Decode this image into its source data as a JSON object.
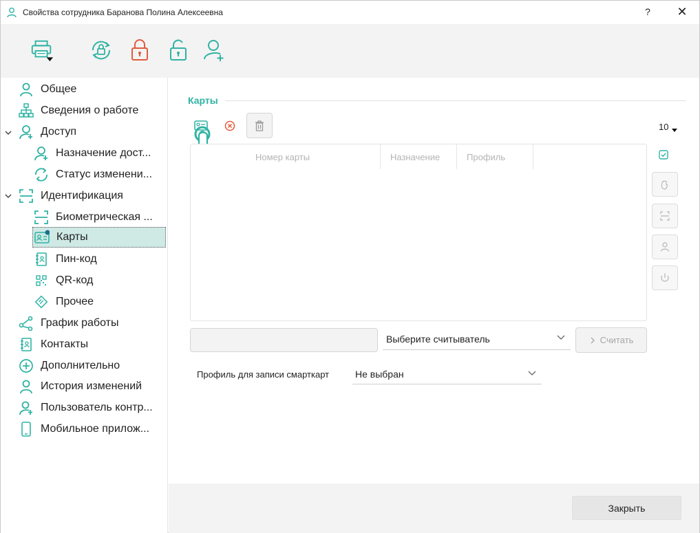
{
  "window": {
    "title": "Свойства сотрудника Баранова Полина  Алексеевна",
    "help_label": "?",
    "close_label": "✕"
  },
  "toolbar": {
    "buttons": [
      {
        "name": "print-icon",
        "color": "#2fb3a3"
      },
      {
        "name": "sync-lock-icon",
        "color": "#2fb3a3"
      },
      {
        "name": "lock-icon",
        "color": "#e25a3c"
      },
      {
        "name": "unlock-icon",
        "color": "#2fb3a3"
      },
      {
        "name": "add-user-icon",
        "color": "#2fb3a3"
      }
    ]
  },
  "sidebar": {
    "items": [
      {
        "label": "Общее",
        "icon": "user-icon"
      },
      {
        "label": "Сведения о работе",
        "icon": "org-chart-icon"
      },
      {
        "label": "Доступ",
        "icon": "user-key-icon"
      },
      {
        "label": "Назначение дост...",
        "icon": "user-key-icon"
      },
      {
        "label": "Статус изменени...",
        "icon": "refresh-icon"
      },
      {
        "label": "Идентификация",
        "icon": "scan-frame-icon"
      },
      {
        "label": "Биометрическая ...",
        "icon": "scan-frame-icon"
      },
      {
        "label": "Карты",
        "icon": "id-card-icon"
      },
      {
        "label": "Пин-код",
        "icon": "notebook-icon"
      },
      {
        "label": "QR-код",
        "icon": "qr-icon"
      },
      {
        "label": "Прочее",
        "icon": "tag-icon"
      },
      {
        "label": "График работы",
        "icon": "share-icon"
      },
      {
        "label": "Контакты",
        "icon": "contacts-icon"
      },
      {
        "label": "Дополнительно",
        "icon": "plus-circle-icon"
      },
      {
        "label": "История изменений",
        "icon": "user-icon"
      },
      {
        "label": "Пользователь контр...",
        "icon": "user-plus-icon"
      },
      {
        "label": "Мобильное прилож...",
        "icon": "phone-icon"
      }
    ]
  },
  "cards": {
    "section_title": "Карты",
    "page_size": "10",
    "columns": [
      "Номер карты",
      "Назначение",
      "Профиль"
    ],
    "reader_placeholder": "Выберите считыватель",
    "read_button": "Считать",
    "profile_label": "Профиль для записи смарткарт",
    "profile_value": "Не выбран"
  },
  "footer": {
    "close_button": "Закрыть"
  },
  "colors": {
    "accent": "#2fb3a3",
    "danger": "#e25a3c",
    "selected_bg": "#cfe9e5"
  }
}
